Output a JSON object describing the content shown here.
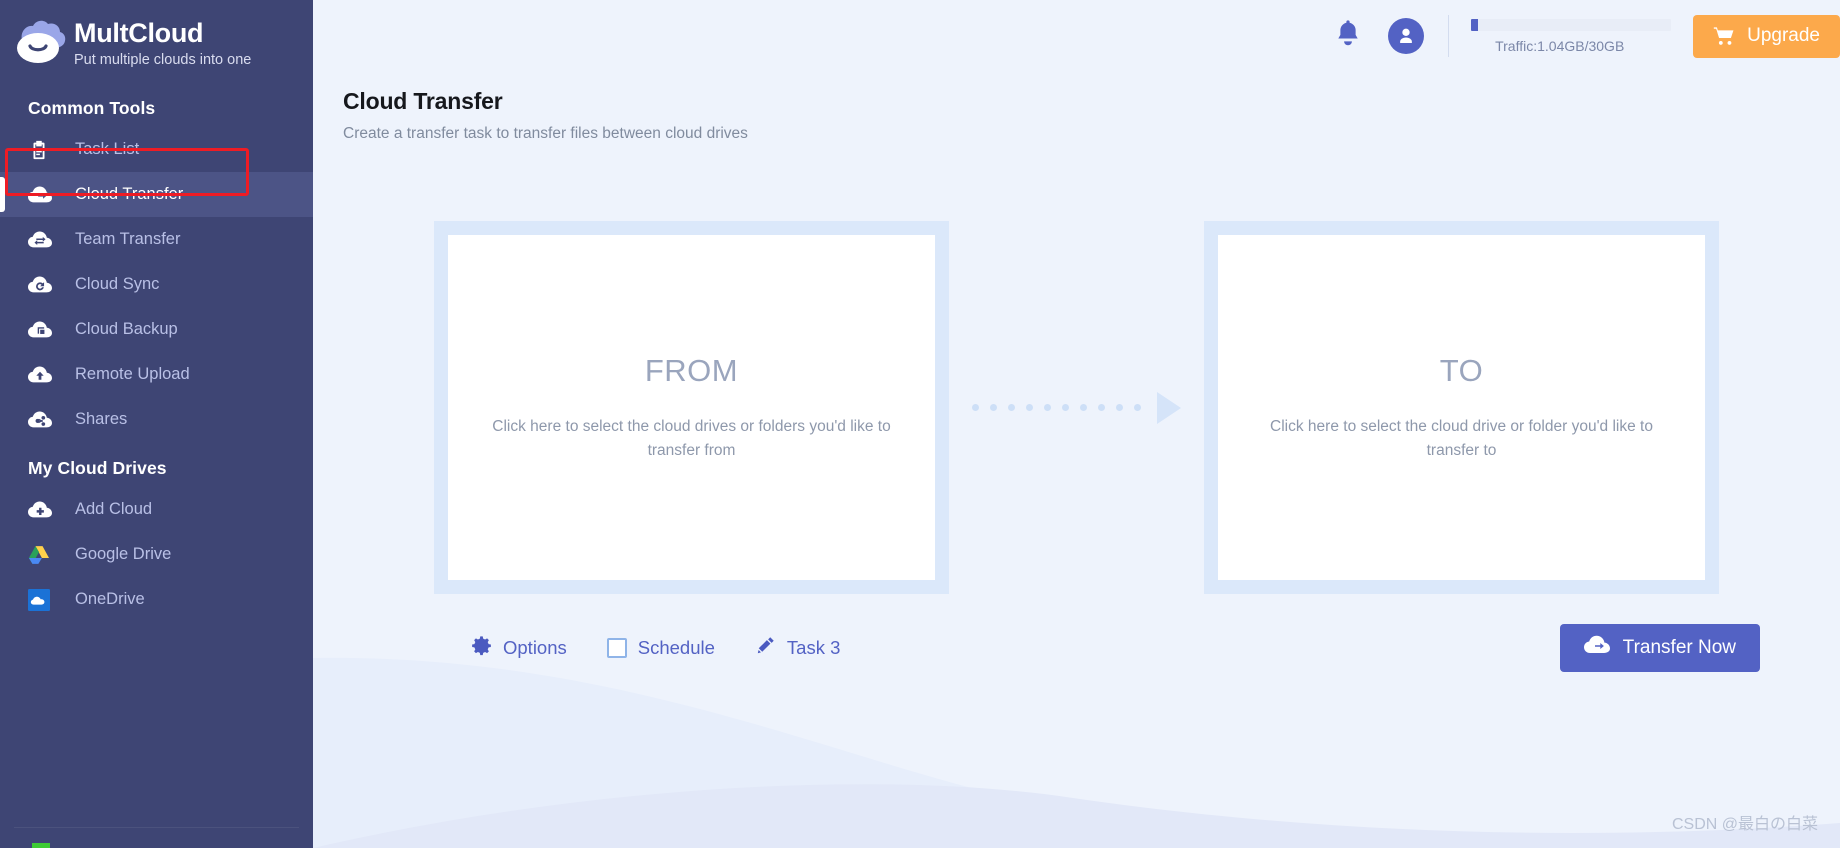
{
  "brand": {
    "name": "MultCloud",
    "tagline": "Put multiple clouds into one",
    "logo_icon": "cloud-logo-icon"
  },
  "sidebar": {
    "sections": [
      {
        "title": "Common Tools",
        "items": [
          {
            "label": "Task List",
            "icon": "clipboard-icon",
            "active": false
          },
          {
            "label": "Cloud Transfer",
            "icon": "cloud-arrow-right-icon",
            "active": true
          },
          {
            "label": "Team Transfer",
            "icon": "cloud-team-transfer-icon",
            "active": false
          },
          {
            "label": "Cloud Sync",
            "icon": "cloud-sync-icon",
            "active": false
          },
          {
            "label": "Cloud Backup",
            "icon": "cloud-backup-icon",
            "active": false
          },
          {
            "label": "Remote Upload",
            "icon": "cloud-upload-icon",
            "active": false
          },
          {
            "label": "Shares",
            "icon": "cloud-share-icon",
            "active": false
          }
        ]
      },
      {
        "title": "My Cloud Drives",
        "items": [
          {
            "label": "Add Cloud",
            "icon": "cloud-plus-icon",
            "active": false
          },
          {
            "label": "Google Drive",
            "icon": "google-drive-icon",
            "active": false
          },
          {
            "label": "OneDrive",
            "icon": "onedrive-icon",
            "active": false
          }
        ]
      }
    ]
  },
  "header": {
    "notification_icon": "bell-icon",
    "avatar_icon": "user-avatar-icon",
    "traffic_label": "Traffic:1.04GB/30GB",
    "traffic_percent": 3.5,
    "upgrade_label": "Upgrade",
    "upgrade_icon": "shopping-cart-icon"
  },
  "page": {
    "title": "Cloud Transfer",
    "subtitle": "Create a transfer task to transfer files between cloud drives"
  },
  "transfer": {
    "from": {
      "kind": "FROM",
      "hint": "Click here to select the cloud drives or folders you'd like to transfer from"
    },
    "to": {
      "kind": "TO",
      "hint": "Click here to select the cloud drive or folder you'd like to transfer to"
    },
    "arrow_icon": "dotted-arrow-right-icon",
    "arrow_dots": 10
  },
  "toolbar": {
    "options_label": "Options",
    "options_icon": "gear-icon",
    "schedule_label": "Schedule",
    "schedule_icon": "checkbox-icon",
    "schedule_checked": false,
    "task_label": "Task 3",
    "task_icon": "pencil-icon",
    "transfer_now_label": "Transfer Now",
    "transfer_now_icon": "cloud-arrow-right-icon"
  },
  "watermark": {
    "text": "CSDN @最白の白菜"
  },
  "colors": {
    "sidebar_bg": "#3e4574",
    "sidebar_active": "#4c5486",
    "accent": "#5362c4",
    "upgrade": "#fca94b",
    "page_bg": "#eef3fc",
    "panel_border": "#dbe8fa",
    "highlight_box": "#ee1c25"
  }
}
